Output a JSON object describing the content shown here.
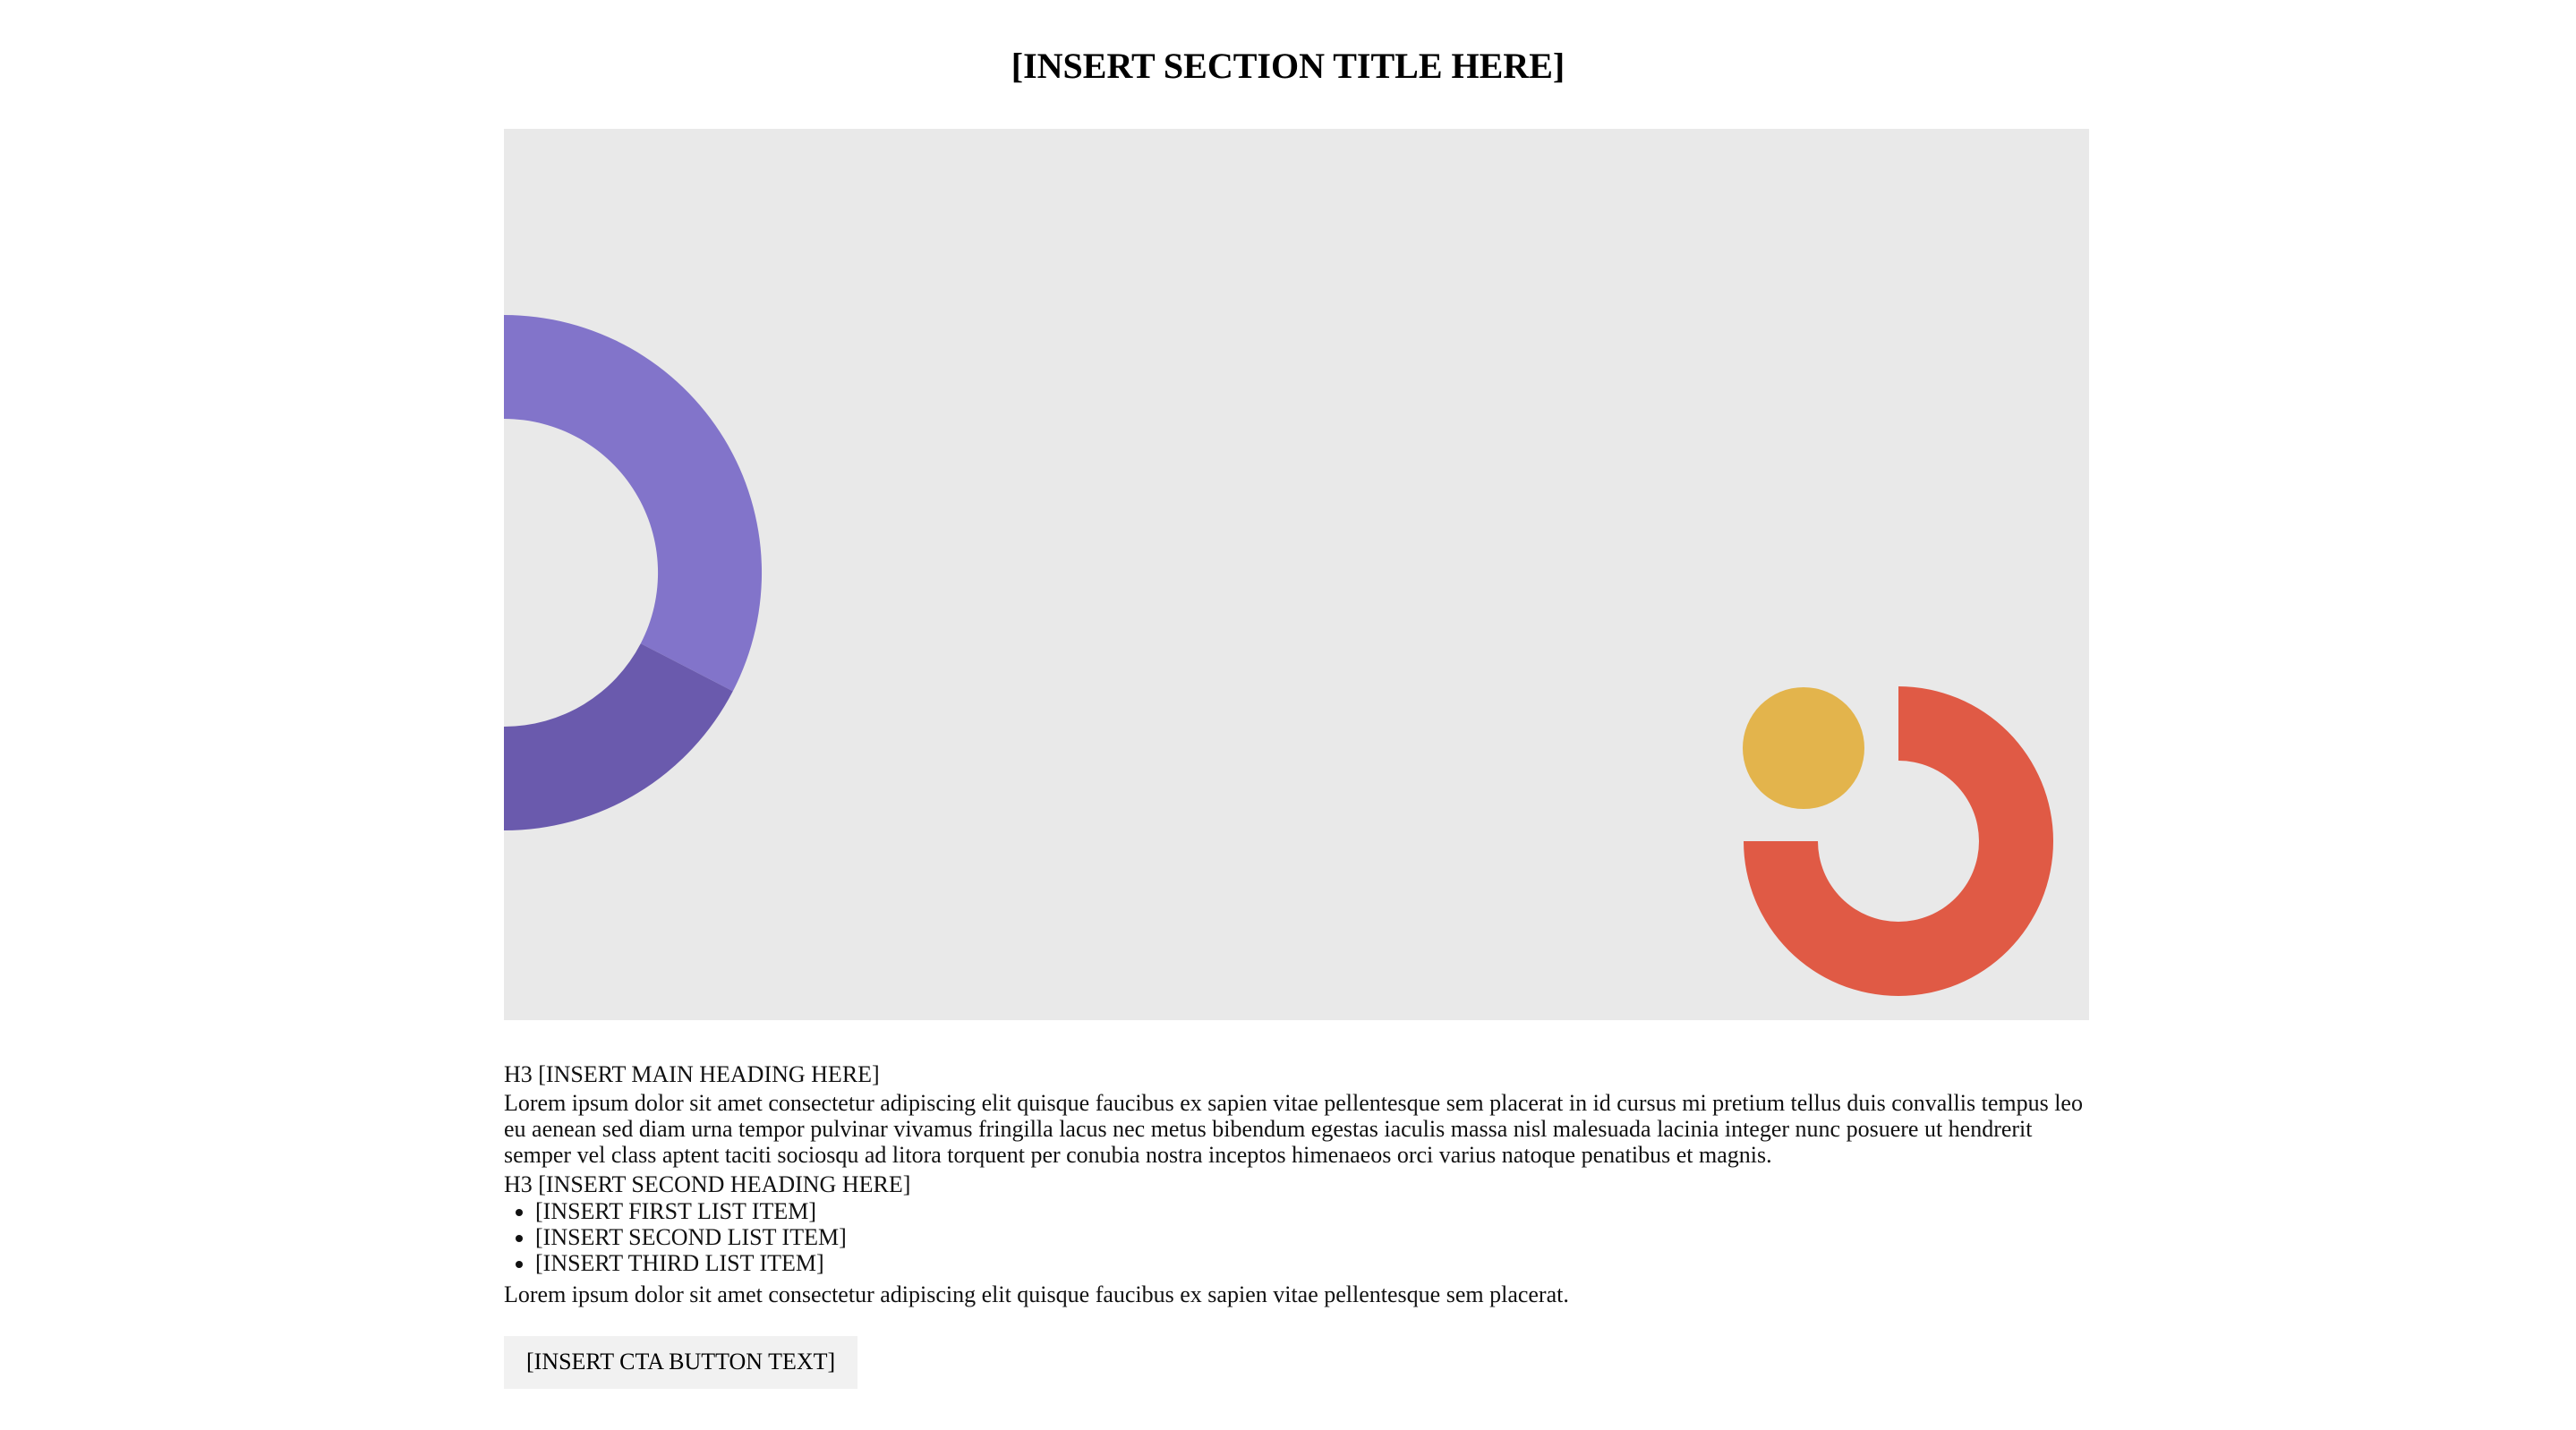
{
  "section": {
    "title": "[INSERT SECTION TITLE HERE]"
  },
  "hero": {
    "colors": {
      "background": "#e9e9e9",
      "purple_light": "#8274ca",
      "purple_dark": "#6a5aad",
      "yellow": "#e3b44c",
      "red": "#e05a45"
    }
  },
  "content": {
    "main_heading": "H3 [INSERT MAIN HEADING HERE]",
    "paragraph_1": "Lorem ipsum dolor sit amet consectetur adipiscing elit quisque faucibus ex sapien vitae pellentesque sem placerat in id cursus mi pretium tellus duis convallis tempus leo eu aenean sed diam urna tempor pulvinar vivamus fringilla lacus nec metus bibendum egestas iaculis massa nisl malesuada lacinia integer nunc posuere ut hendrerit semper vel class aptent taciti sociosqu ad litora torquent per conubia nostra inceptos himenaeos orci varius natoque penatibus et magnis.",
    "second_heading": "H3 [INSERT SECOND HEADING HERE]",
    "list": [
      "[INSERT FIRST LIST ITEM]",
      "[INSERT SECOND LIST ITEM]",
      "[INSERT THIRD LIST ITEM]"
    ],
    "paragraph_2": "Lorem ipsum dolor sit amet consectetur adipiscing elit quisque faucibus ex sapien vitae pellentesque sem placerat.",
    "cta_label": "[INSERT CTA BUTTON TEXT]"
  }
}
